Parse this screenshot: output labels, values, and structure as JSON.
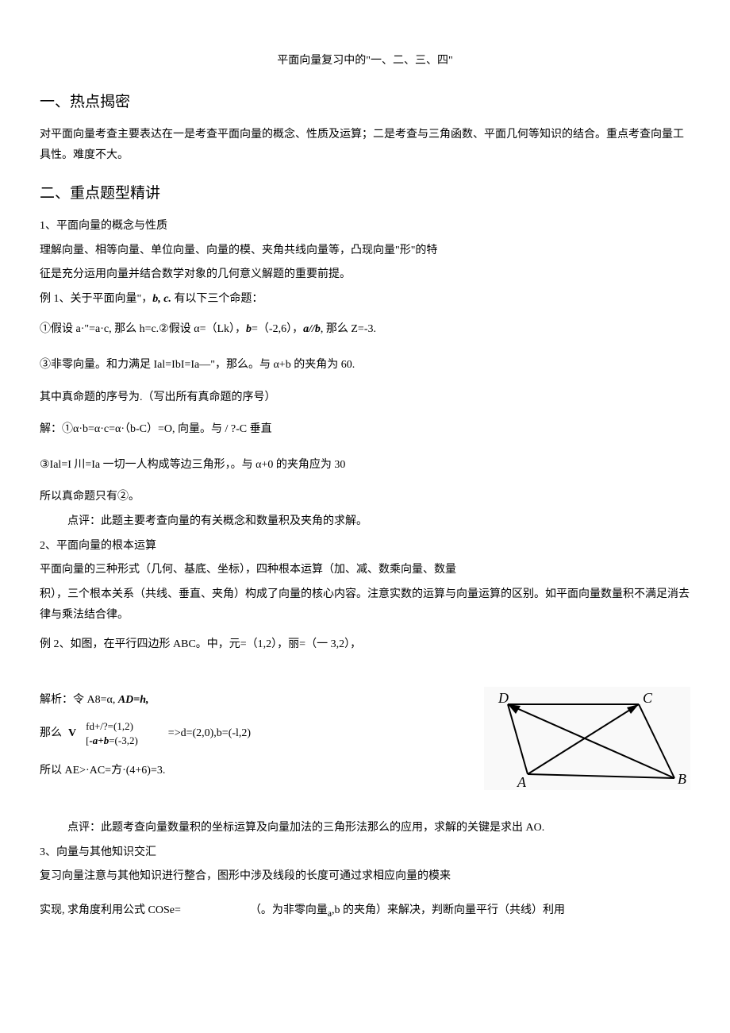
{
  "title": "平面向量复习中的\"一、二、三、四\"",
  "s1": {
    "heading": "一、热点揭密",
    "p1": "对平面向量考查主要表达在一是考查平面向量的概念、性质及运算；二是考查与三角函数、平面几何等知识的结合。重点考查向量工具性。难度不大。"
  },
  "s2": {
    "heading": "二、重点题型精讲",
    "sub1_title": "1、平面向量的概念与性质",
    "sub1_p1": "理解向量、相等向量、单位向量、向量的模、夹角共线向量等，凸现向量\"形\"的特",
    "sub1_p2": "征是充分运用向量并结合数学对象的几何意义解题的重要前提。",
    "ex1_intro_a": "例 1、关于平面向量\"，",
    "ex1_intro_b": "b, c.",
    "ex1_intro_c": " 有以下三个命题：",
    "ex1_item1_a": "①假设 a·\"=a·c, 那么 h=c.②假设 α=（Lk），",
    "ex1_item1_b": "b",
    "ex1_item1_c": "=（-2,6），",
    "ex1_item1_d": "a//b",
    "ex1_item1_e": ", 那么 Z=-3.",
    "ex1_item3": "③非零向量。和力满足 Ial=IbI=Ia—\"，那么。与 α+b 的夹角为 60.",
    "ex1_q": "其中真命题的序号为.（写出所有真命题的序号）",
    "ex1_sol1": "解：①α·b=α·c=α·（b-C）=O, 向量。与 / ?-C 垂直",
    "ex1_sol3": "③Ial=I 川=Ia 一切一人构成等边三角形，。与 α+0 的夹角应为 30",
    "ex1_ans": "所以真命题只有②。",
    "ex1_comment": "点评：此题主要考查向量的有关概念和数量积及夹角的求解。",
    "sub2_title": "2、平面向量的根本运算",
    "sub2_p1": "平面向量的三种形式（几何、基底、坐标），四种根本运算（加、减、数乘向量、数量",
    "sub2_p2": "积），三个根本关系（共线、垂直、夹角）构成了向量的核心内容。注意实数的运算与向量运算的区别。如平面向量数量积不满足消去律与乘法结合律。",
    "ex2_intro": "例 2、如图，在平行四边形 ABC。中，元=（1,2），丽=（一 3,2），",
    "ex2_sol_a": "解析：令 A8=α, ",
    "ex2_sol_b": "AD=h,",
    "ex2_eq_pre": "那么 ",
    "ex2_eq_v": "V",
    "ex2_eq_top": "fd+/?=(1,2)",
    "ex2_eq_bot_a": "[",
    "ex2_eq_bot_b": "-a+b",
    "ex2_eq_bot_c": "=(-3,2)",
    "ex2_eq_right": "=>d=(2,0),b=(-l,2)",
    "ex2_result": "所以 AE>·AC=方·(4+6)=3.",
    "ex2_comment": "点评：此题考查向量数量积的坐标运算及向量加法的三角形法那么的应用，求解的关键是求出 AO.",
    "sub3_title": "3、向量与其他知识交汇",
    "sub3_p1": "复习向量注意与其他知识进行整合，图形中涉及线段的长度可通过求相应向量的模来",
    "sub3_p2a": "实现, 求角度利用公式 COSe=",
    "sub3_p2b": "（。为非零向量",
    "sub3_p2sub": "a",
    "sub3_p2c": ",b 的夹角）来解决，判断向量平行（共线）利用"
  },
  "fig": {
    "A": "A",
    "B": "B",
    "C": "C",
    "D": "D"
  }
}
